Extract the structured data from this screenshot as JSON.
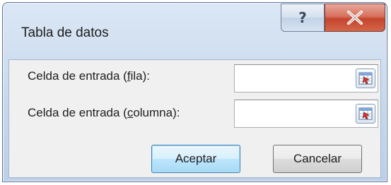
{
  "dialog": {
    "title": "Tabla de datos",
    "help_glyph": "?",
    "close_glyph": "X"
  },
  "fields": {
    "row_input": {
      "label_pre": "Celda de entrada (",
      "label_accel": "f",
      "label_post": "ila):",
      "value": ""
    },
    "column_input": {
      "label_pre": "Celda de entrada (",
      "label_accel": "c",
      "label_post": "olumna):",
      "value": ""
    }
  },
  "buttons": {
    "ok_label": "Aceptar",
    "cancel_label": "Cancelar"
  },
  "colors": {
    "title_gradient_top": "#dbe7f5",
    "client_bg": "#f0f0f0",
    "close_red": "#c4452d",
    "default_button_blue": "#3c7fb1"
  },
  "icons": {
    "help": "help-icon",
    "close": "close-icon",
    "range_select": "range-select-icon"
  }
}
